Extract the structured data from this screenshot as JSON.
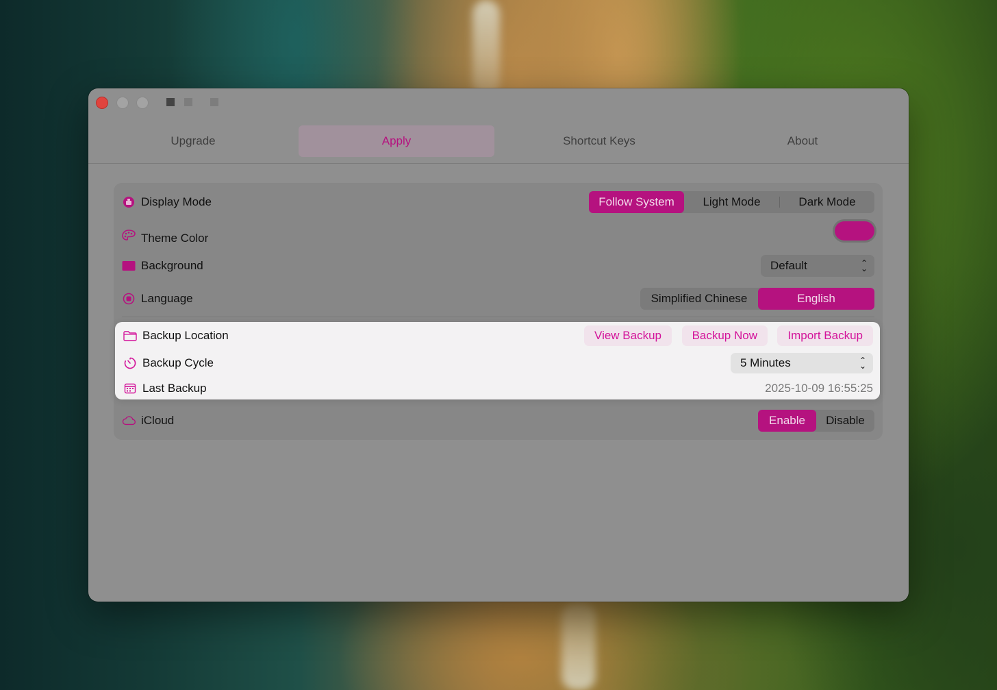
{
  "window": {
    "tabs": [
      {
        "label": "Upgrade",
        "active": false
      },
      {
        "label": "Apply",
        "active": true
      },
      {
        "label": "Shortcut Keys",
        "active": false
      },
      {
        "label": "About",
        "active": false
      }
    ]
  },
  "settings": {
    "display_mode": {
      "label": "Display Mode",
      "icon": "display-mode-icon",
      "options": [
        "Follow System",
        "Light Mode",
        "Dark Mode"
      ],
      "selected": "Follow System"
    },
    "theme_color": {
      "label": "Theme Color",
      "icon": "palette-icon",
      "color": "#b5127f"
    },
    "background": {
      "label": "Background",
      "icon": "background-icon",
      "value": "Default"
    },
    "language": {
      "label": "Language",
      "icon": "language-icon",
      "options": [
        "Simplified Chinese",
        "English"
      ],
      "selected": "English"
    },
    "backup_location": {
      "label": "Backup Location",
      "icon": "folder-icon",
      "buttons": [
        "View Backup",
        "Backup Now",
        "Import Backup"
      ]
    },
    "backup_cycle": {
      "label": "Backup Cycle",
      "icon": "timer-icon",
      "value": "5 Minutes"
    },
    "last_backup": {
      "label": "Last Backup",
      "icon": "calendar-icon",
      "value": "2025-10-09 16:55:25"
    },
    "icloud": {
      "label": "iCloud",
      "icon": "cloud-icon",
      "options": [
        "Enable",
        "Disable"
      ],
      "selected": "Enable"
    }
  },
  "colors": {
    "accent": "#b5127f",
    "accent_text": "#d3139a"
  }
}
